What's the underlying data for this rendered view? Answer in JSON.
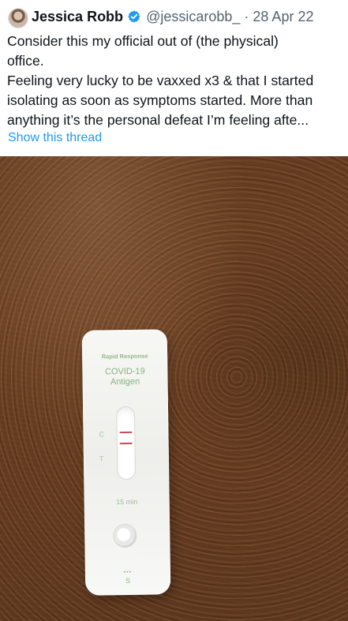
{
  "tweet": {
    "author_name": "Jessica Robb",
    "handle": "@jessicarobb_",
    "date": "28 Apr 22",
    "verified_icon": "verified-badge-icon",
    "text_lines": [
      "Consider this my official out of (the physical)",
      "office.",
      "Feeling very lucky to be vaxxed x3 & that I started",
      "isolating as soon as symptoms started. More than",
      "anything it’s the personal defeat I’m feeling afte..."
    ],
    "show_thread_label": "Show this thread"
  },
  "photo": {
    "test_brand": "Rapid Response",
    "test_line_1": "COVID-19",
    "test_line_2": "Antigen",
    "control_label": "C",
    "test_label": "T",
    "time_label": "15 min",
    "well_dots": "•••",
    "well_label": "S"
  },
  "colors": {
    "link": "#1d9bf0",
    "verified": "#1d9bf0",
    "positive_line": "#c84a5a"
  }
}
